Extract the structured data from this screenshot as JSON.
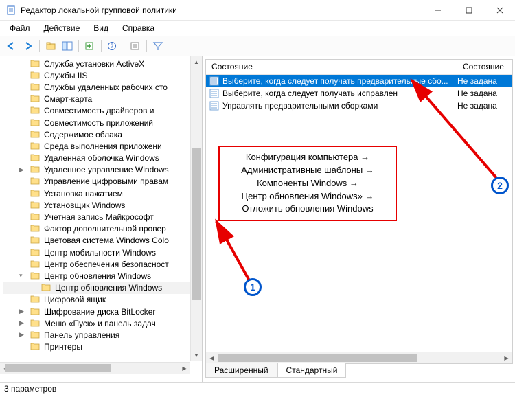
{
  "window": {
    "title": "Редактор локальной групповой политики"
  },
  "menu": {
    "file": "Файл",
    "action": "Действие",
    "view": "Вид",
    "help": "Справка"
  },
  "tree": {
    "items": [
      {
        "label": "Служба установки ActiveX"
      },
      {
        "label": "Службы IIS"
      },
      {
        "label": "Службы удаленных рабочих сто"
      },
      {
        "label": "Смарт-карта"
      },
      {
        "label": "Совместимость драйверов и"
      },
      {
        "label": "Совместимость приложений"
      },
      {
        "label": "Содержимое облака"
      },
      {
        "label": "Среда выполнения приложени"
      },
      {
        "label": "Удаленная оболочка Windows"
      },
      {
        "label": "Удаленное управление Windows",
        "expand": ">"
      },
      {
        "label": "Управление цифровыми правам"
      },
      {
        "label": "Установка нажатием"
      },
      {
        "label": "Установщик Windows"
      },
      {
        "label": "Учетная запись Майкрософт"
      },
      {
        "label": "Фактор дополнительной провер"
      },
      {
        "label": "Цветовая система Windows Colo"
      },
      {
        "label": "Центр мобильности Windows"
      },
      {
        "label": "Центр обеспечения безопасност"
      },
      {
        "label": "Центр обновления Windows",
        "expand": "v"
      },
      {
        "label": "Центр обновления Windows",
        "indent": true,
        "selected": true
      },
      {
        "label": "Цифровой ящик"
      },
      {
        "label": "Шифрование диска BitLocker",
        "expand": ">"
      },
      {
        "label": "Меню «Пуск» и панель задач",
        "expand": ">"
      },
      {
        "label": "Панель управления",
        "expand": ">"
      },
      {
        "label": "Принтеры"
      }
    ]
  },
  "list": {
    "header_name": "Состояние",
    "header_state": "Состояние",
    "rows": [
      {
        "label": "Выберите, когда следует получать предварительные сбо...",
        "state": "Не задана",
        "selected": true
      },
      {
        "label": "Выберите, когда следует получать исправлен",
        "state": "Не задана"
      },
      {
        "label": "Управлять предварительными сборками",
        "state": "Не задана"
      }
    ]
  },
  "tabs": {
    "extended": "Расширенный",
    "standard": "Стандартный"
  },
  "status": {
    "text": "3 параметров"
  },
  "annotation": {
    "line1": "Конфигурация компьютера →",
    "line2": "Административные шаблоны →",
    "line3": "Компоненты Windows →",
    "line4": "Центр обновления Windows» →",
    "line5": "Отложить обновления Windows",
    "num1": "1",
    "num2": "2"
  },
  "icons": {
    "back": "←",
    "fwd": "→",
    "up": "▲",
    "down": "▼",
    "left": "◀",
    "right": "▶"
  }
}
